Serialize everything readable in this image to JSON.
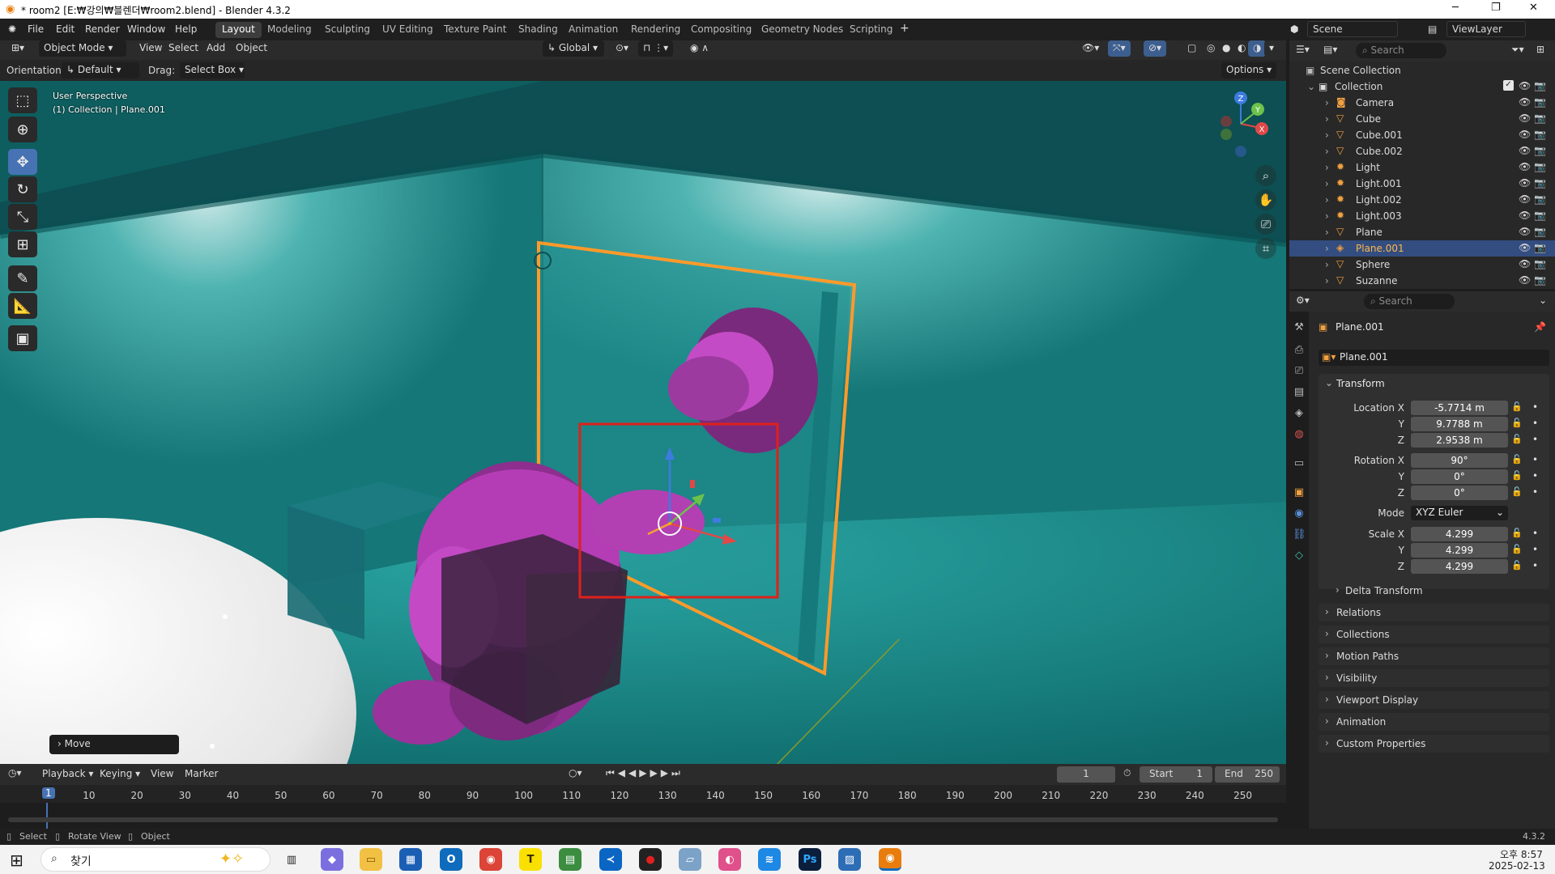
{
  "window": {
    "title": "* room2 [E:₩강의₩블렌더₩room2.blend] - Blender 4.3.2",
    "controls": {
      "minimize": "─",
      "maximize": "❐",
      "close": "✕"
    }
  },
  "menu": [
    "File",
    "Edit",
    "Render",
    "Window",
    "Help"
  ],
  "workspaces": [
    "Layout",
    "Modeling",
    "Sculpting",
    "UV Editing",
    "Texture Paint",
    "Shading",
    "Animation",
    "Rendering",
    "Compositing",
    "Geometry Nodes",
    "Scripting"
  ],
  "active_workspace": "Layout",
  "scene": {
    "name": "Scene",
    "view_layer": "ViewLayer"
  },
  "viewport_header": {
    "mode": "Object Mode",
    "menus": [
      "View",
      "Select",
      "Add",
      "Object"
    ],
    "transform_orientation": "Global"
  },
  "tool_header": {
    "orientation_label": "Orientation:",
    "orientation_value": "Default",
    "drag_label": "Drag:",
    "drag_value": "Select Box",
    "options": "Options"
  },
  "viewport": {
    "perspective_label": "User Perspective",
    "context_label": "(1) Collection | Plane.001",
    "last_op": "Move",
    "gizmo_axes": {
      "x": "X",
      "y": "Y",
      "z": "Z"
    },
    "colors": {
      "selected_outline": "#ff9a2a",
      "highlight_box": "#e0201a",
      "wall": "#1f8a8a"
    }
  },
  "outliner": {
    "search_placeholder": "Search",
    "root": "Scene Collection",
    "collection": "Collection",
    "objects": [
      {
        "name": "Camera",
        "icon": "camera-icon"
      },
      {
        "name": "Cube",
        "icon": "mesh-icon"
      },
      {
        "name": "Cube.001",
        "icon": "mesh-icon"
      },
      {
        "name": "Cube.002",
        "icon": "mesh-icon"
      },
      {
        "name": "Light",
        "icon": "light-icon"
      },
      {
        "name": "Light.001",
        "icon": "light-icon"
      },
      {
        "name": "Light.002",
        "icon": "light-icon"
      },
      {
        "name": "Light.003",
        "icon": "light-icon"
      },
      {
        "name": "Plane",
        "icon": "mesh-icon"
      },
      {
        "name": "Plane.001",
        "icon": "lightprobe-icon",
        "selected": true
      },
      {
        "name": "Sphere",
        "icon": "mesh-icon"
      },
      {
        "name": "Suzanne",
        "icon": "mesh-icon"
      }
    ]
  },
  "properties": {
    "search_placeholder": "Search",
    "object_name": "Plane.001",
    "object_field": "Plane.001",
    "transform_title": "Transform",
    "location": {
      "label": "Location X",
      "x": "-5.7714 m",
      "y": "9.7788 m",
      "z": "2.9538 m"
    },
    "rotation": {
      "label": "Rotation X",
      "x": "90°",
      "y": "0°",
      "z": "0°"
    },
    "mode": {
      "label": "Mode",
      "value": "XYZ Euler"
    },
    "scale": {
      "label": "Scale X",
      "x": "4.299",
      "y": "4.299",
      "z": "4.299"
    },
    "axis_y": "Y",
    "axis_z": "Z",
    "delta_transform": "Delta Transform",
    "sections": [
      "Relations",
      "Collections",
      "Motion Paths",
      "Visibility",
      "Viewport Display",
      "Animation",
      "Custom Properties"
    ]
  },
  "timeline": {
    "menus": [
      "Playback",
      "Keying",
      "View",
      "Marker"
    ],
    "current_frame": "1",
    "start_label": "Start",
    "start": "1",
    "end_label": "End",
    "end": "250",
    "ticks": [
      "1",
      "10",
      "20",
      "30",
      "40",
      "50",
      "60",
      "70",
      "80",
      "90",
      "100",
      "110",
      "120",
      "130",
      "140",
      "150",
      "160",
      "170",
      "180",
      "190",
      "200",
      "210",
      "220",
      "230",
      "240",
      "250"
    ]
  },
  "statusbar": {
    "select": "Select",
    "rotate": "Rotate View",
    "object": "Object",
    "version": "4.3.2"
  },
  "taskbar": {
    "search": "찾기",
    "time": "오후 8:57",
    "date": "2025-02-13"
  }
}
